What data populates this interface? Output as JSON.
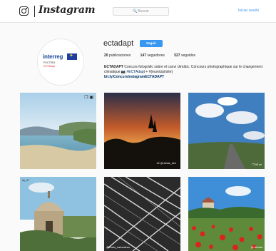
{
  "nav": {
    "logo_icon": "instagram-glyph-icon",
    "wordmark": "Instagram",
    "search_placeholder": "Buscar",
    "login_label": "Iniciar sesión"
  },
  "profile": {
    "avatar_logo": {
      "title": "interreg",
      "line1": "POCTEFA",
      "line2": "ECTAdapt"
    },
    "username": "ectadapt",
    "follow_label": "Seguir",
    "stats": {
      "posts_count": "20",
      "posts_label": "publicaciones",
      "followers_count": "147",
      "followers_label": "seguidores",
      "following_count": "527",
      "following_label": "seguidos"
    },
    "bio": {
      "name": "ECTADAPT",
      "text1": "Concurs fotogràfic sobre el canvi climàtic. Concours photographique sur le changement climatique",
      "camera": "📷",
      "hashtag": "#ECTAdapt",
      "text2": "+ #[municipi/site]",
      "link": "bit.ly/ConcursInstagramECTADAPT"
    }
  },
  "posts": [
    {
      "badge_icon": "multiple-photos-icon",
      "badge": "❐ ▣"
    },
    {
      "caption": "12 @ lanas_se1"
    },
    {
      "caption": "❐ 99 mi"
    },
    {
      "caption": "dy_07"
    },
    {
      "caption": "@chain_naturaleza"
    },
    {
      "caption": "@ stodoa"
    }
  ],
  "colors": {
    "accent": "#3897f0",
    "link": "#003569",
    "text": "#262626"
  }
}
